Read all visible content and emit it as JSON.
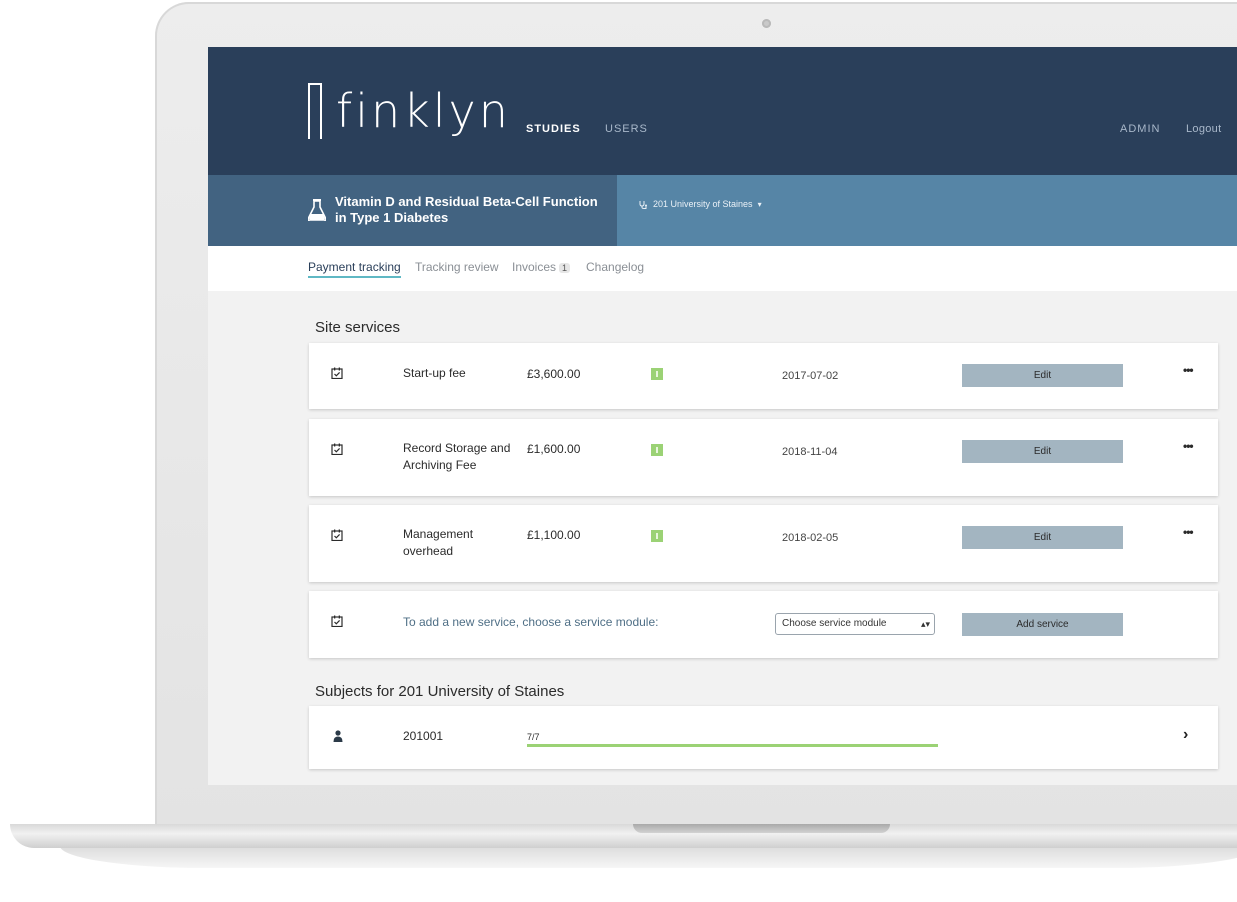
{
  "app": {
    "logo_text": "finklyn"
  },
  "nav": {
    "studies": "STUDIES",
    "users": "USERS",
    "admin": "ADMIN",
    "logout": "Logout"
  },
  "study": {
    "title": "Vitamin D and Residual Beta-Cell Function in Type 1 Diabetes",
    "site": "201 University of Staines",
    "icon": "flask-icon"
  },
  "tabs": [
    {
      "label": "Payment tracking",
      "active": true
    },
    {
      "label": "Tracking review"
    },
    {
      "label": "Invoices",
      "badge": "1"
    },
    {
      "label": "Changelog"
    }
  ],
  "site_services": {
    "title": "Site services",
    "items": [
      {
        "name": "Start-up fee",
        "price": "£3,600.00",
        "date": "2017-07-02",
        "action": "Edit"
      },
      {
        "name": "Record Storage and Archiving Fee",
        "price": "£1,600.00",
        "date": "2018-11-04",
        "action": "Edit"
      },
      {
        "name": "Management overhead",
        "price": "£1,100.00",
        "date": "2018-02-05",
        "action": "Edit"
      }
    ],
    "add_text": "To add a new service, choose a service module:",
    "module_select": "Choose service module",
    "add_button": "Add service"
  },
  "subjects": {
    "title": "Subjects for 201 University of Staines",
    "items": [
      {
        "id": "201001",
        "progress_label": "7/7",
        "progress": 1.0
      }
    ]
  },
  "colors": {
    "topbar": "#2a3f5a",
    "study_left": "#426381",
    "study_right": "#5685a6",
    "tab_underline": "#5fb8c4",
    "status_green": "#9bd275",
    "edit_button": "#a3b5c1"
  }
}
